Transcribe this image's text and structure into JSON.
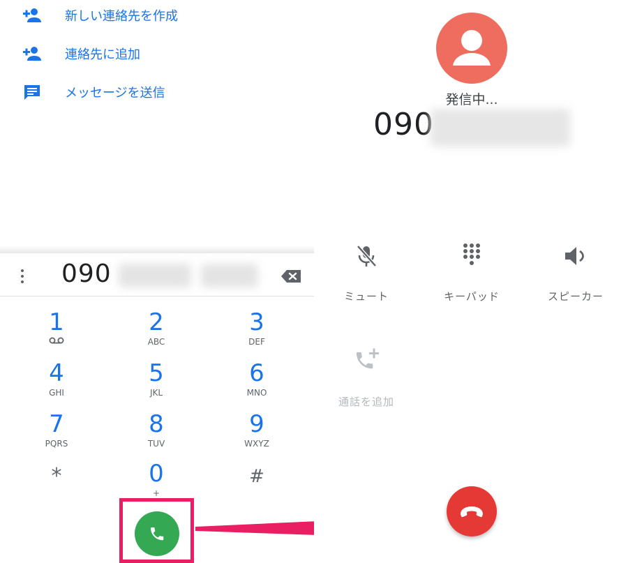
{
  "dialer": {
    "suggestions": [
      {
        "label": "新しい連絡先を作成",
        "icon": "person-add-icon"
      },
      {
        "label": "連絡先に追加",
        "icon": "person-add-icon"
      },
      {
        "label": "メッセージを送信",
        "icon": "message-icon"
      }
    ],
    "dialed_number_visible": "090",
    "keys": [
      {
        "digit": "1",
        "letters": ""
      },
      {
        "digit": "2",
        "letters": "ABC"
      },
      {
        "digit": "3",
        "letters": "DEF"
      },
      {
        "digit": "4",
        "letters": "GHI"
      },
      {
        "digit": "5",
        "letters": "JKL"
      },
      {
        "digit": "6",
        "letters": "MNO"
      },
      {
        "digit": "7",
        "letters": "PQRS"
      },
      {
        "digit": "8",
        "letters": "TUV"
      },
      {
        "digit": "9",
        "letters": "WXYZ"
      },
      {
        "digit": "*",
        "letters": ""
      },
      {
        "digit": "0",
        "letters": "+"
      },
      {
        "digit": "#",
        "letters": ""
      }
    ]
  },
  "call": {
    "status": "発信中...",
    "number_visible": "090",
    "controls": {
      "mute": "ミュート",
      "keypad": "キーパッド",
      "speaker": "スピーカー",
      "add_call": "通話を追加"
    }
  },
  "colors": {
    "accent_blue": "#1a73e8",
    "call_green": "#34a853",
    "end_call_red": "#e53935",
    "avatar_red": "#ee6d5f",
    "highlight_pink": "#e91e63"
  }
}
